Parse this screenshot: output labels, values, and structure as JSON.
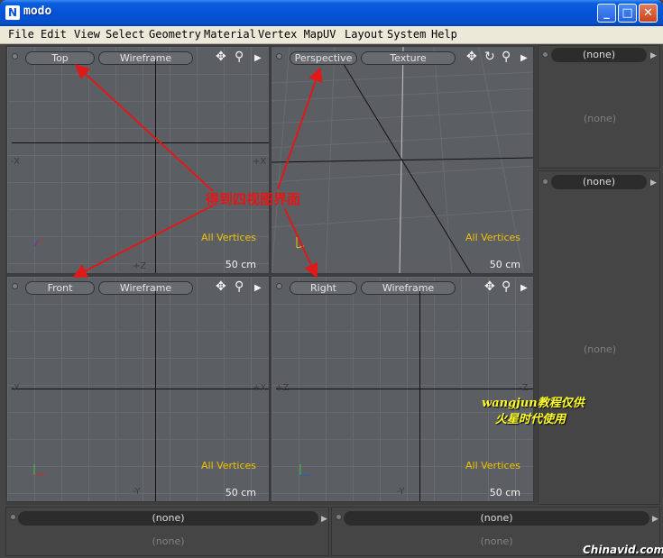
{
  "window": {
    "title": "modo",
    "icon_glyph": "N",
    "minimize": "_",
    "maximize": "□",
    "close": "✕"
  },
  "menu": [
    "File",
    "Edit",
    "View",
    "Select",
    "Geometry",
    "Material",
    "Vertex Map",
    "UV",
    "Layout",
    "System",
    "Help"
  ],
  "viewports": {
    "top": {
      "view": "Top",
      "mode": "Wireframe",
      "axis_left": "-X",
      "axis_right": "+X",
      "axis_bottom": "+Z",
      "status": "All Vertices",
      "scale": "50 cm"
    },
    "persp": {
      "view": "Perspective",
      "mode": "Texture",
      "status": "All Vertices",
      "scale": "50 cm"
    },
    "front": {
      "view": "Front",
      "mode": "Wireframe",
      "axis_left": "-X",
      "axis_right": "+X",
      "axis_bottom": "-Y",
      "status": "All Vertices",
      "scale": "50 cm"
    },
    "right": {
      "view": "Right",
      "mode": "Wireframe",
      "axis_left": "+Z",
      "axis_right": "-Z",
      "axis_bottom": "-Y",
      "status": "All Vertices",
      "scale": "50 cm"
    }
  },
  "right_panels": [
    {
      "header": "(none)",
      "body": "(none)"
    },
    {
      "header": "(none)",
      "body": "(none)"
    }
  ],
  "bottom_panels": [
    {
      "header": "(none)",
      "body": "(none)"
    },
    {
      "header": "(none)",
      "body": "(none)"
    }
  ],
  "annotation": "得到四视图界面",
  "watermark": {
    "line1": "wangjun教程仅供",
    "line2": "火星时代使用",
    "site": "Chinavid.com"
  },
  "colors": {
    "status_text": "#f0c000",
    "annotation_arrow": "#e01818",
    "viewport_bg": "#5b5f64"
  }
}
